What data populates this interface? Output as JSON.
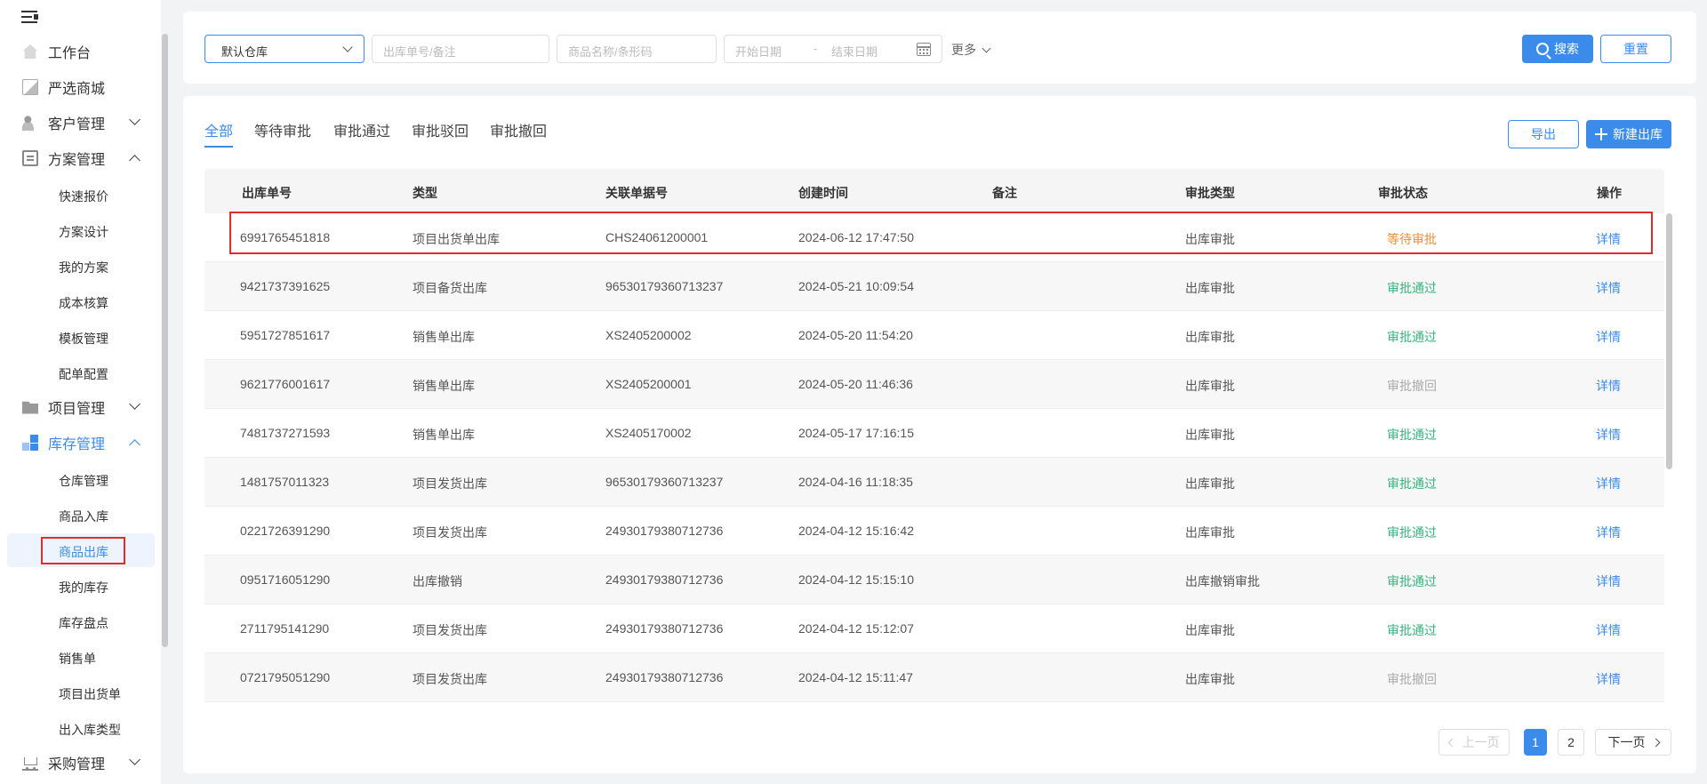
{
  "sidebar": {
    "items": [
      {
        "label": "工作台"
      },
      {
        "label": "严选商城"
      },
      {
        "label": "客户管理"
      },
      {
        "label": "方案管理"
      },
      {
        "label": "项目管理"
      },
      {
        "label": "库存管理"
      },
      {
        "label": "采购管理"
      }
    ],
    "plan_sub": [
      "快速报价",
      "方案设计",
      "我的方案",
      "成本核算",
      "模板管理",
      "配单配置"
    ],
    "stock_sub": [
      "仓库管理",
      "商品入库",
      "商品出库",
      "我的库存",
      "库存盘点",
      "销售单",
      "项目出货单",
      "出入库类型"
    ]
  },
  "filters": {
    "warehouse": "默认仓库",
    "order_placeholder": "出库单号/备注",
    "goods_placeholder": "商品名称/条形码",
    "start_date": "开始日期",
    "date_sep": "-",
    "end_date": "结束日期",
    "more": "更多",
    "search": "搜索",
    "reset": "重置"
  },
  "tabs": [
    "全部",
    "等待审批",
    "审批通过",
    "审批驳回",
    "审批撤回"
  ],
  "actions": {
    "export": "导出",
    "new": "新建出库"
  },
  "table": {
    "headers": [
      "出库单号",
      "类型",
      "关联单据号",
      "创建时间",
      "备注",
      "审批类型",
      "审批状态",
      "操作"
    ],
    "rows": [
      [
        "6991765451818",
        "项目出货单出库",
        "CHS24061200001",
        "2024-06-12 17:47:50",
        "",
        "出库审批",
        "等待审批",
        "详情"
      ],
      [
        "9421737391625",
        "项目备货出库",
        "96530179360713237",
        "2024-05-21 10:09:54",
        "",
        "出库审批",
        "审批通过",
        "详情"
      ],
      [
        "5951727851617",
        "销售单出库",
        "XS2405200002",
        "2024-05-20 11:54:20",
        "",
        "出库审批",
        "审批通过",
        "详情"
      ],
      [
        "9621776001617",
        "销售单出库",
        "XS2405200001",
        "2024-05-20 11:46:36",
        "",
        "出库审批",
        "审批撤回",
        "详情"
      ],
      [
        "7481737271593",
        "销售单出库",
        "XS2405170002",
        "2024-05-17 17:16:15",
        "",
        "出库审批",
        "审批通过",
        "详情"
      ],
      [
        "1481757011323",
        "项目发货出库",
        "96530179360713237",
        "2024-04-16 11:18:35",
        "",
        "出库审批",
        "审批通过",
        "详情"
      ],
      [
        "0221726391290",
        "项目发货出库",
        "24930179380712736",
        "2024-04-12 15:16:42",
        "",
        "出库审批",
        "审批通过",
        "详情"
      ],
      [
        "0951716051290",
        "出库撤销",
        "24930179380712736",
        "2024-04-12 15:15:10",
        "",
        "出库撤销审批",
        "审批通过",
        "详情"
      ],
      [
        "2711795141290",
        "项目发货出库",
        "24930179380712736",
        "2024-04-12 15:12:07",
        "",
        "出库审批",
        "审批通过",
        "详情"
      ],
      [
        "0721795051290",
        "项目发货出库",
        "24930179380712736",
        "2024-04-12 15:11:47",
        "",
        "出库审批",
        "审批撤回",
        "详情"
      ]
    ]
  },
  "pagination": {
    "prev": "上一页",
    "pages": [
      "1",
      "2"
    ],
    "next": "下一页"
  },
  "colors": {
    "accent": "#3b8bea",
    "wait": "#f08c35",
    "pass": "#36b37e",
    "cancel": "#aaaaaa",
    "highlight": "#e52a2a"
  }
}
